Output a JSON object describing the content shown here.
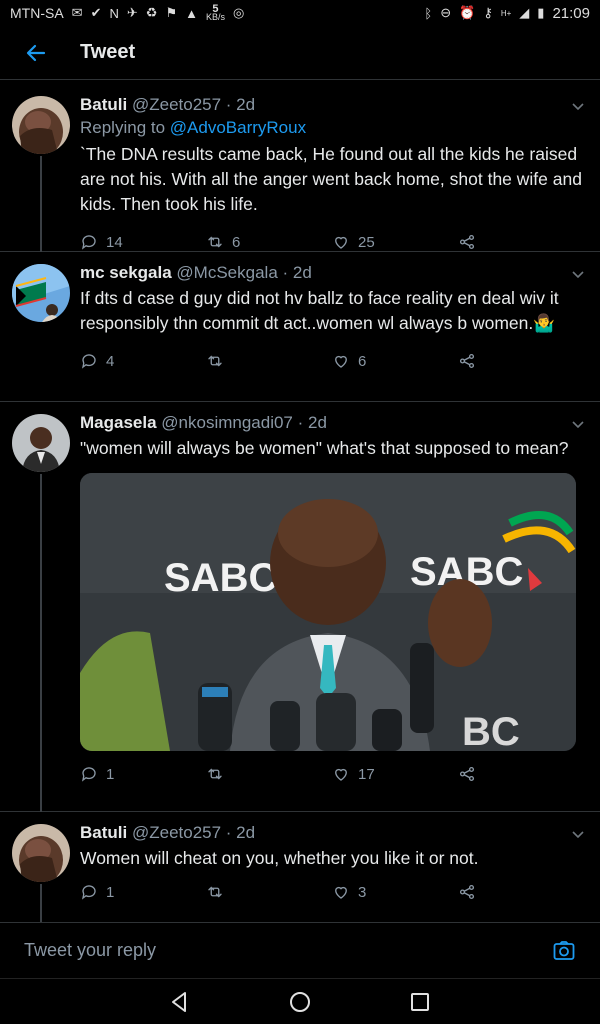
{
  "status_bar": {
    "carrier": "MTN-SA",
    "kb_value": "5",
    "kb_unit": "KB/s",
    "time": "21:09",
    "network": "H+"
  },
  "header": {
    "title": "Tweet",
    "back_icon": "arrow-left-icon"
  },
  "colors": {
    "accent": "#1d9bf0",
    "background": "#000000",
    "text": "#e7e9ea",
    "muted": "#8b98a5",
    "divider": "#2f3336"
  },
  "tweets": [
    {
      "name": "Batuli",
      "handle": "@Zeeto257",
      "age": "· 2d",
      "replying_prefix": "Replying to ",
      "replying_to": "@AdvoBarryRoux",
      "text": "`The DNA results came back, He found out all the kids he raised are not his. With all the anger went back home, shot the wife and kids. Then took his life.",
      "replies": "14",
      "retweets": "6",
      "likes": "25"
    },
    {
      "name": "mc sekgala",
      "handle": "@McSekgala",
      "age": "· 2d",
      "text": "If dts d case d guy did not hv ballz to face reality en deal wiv it responsibly thn commit dt act..women wl always b women.🤷‍♂",
      "replies": "4",
      "retweets": "",
      "likes": "6"
    },
    {
      "name": "Magasela",
      "handle": "@nkosimngadi07",
      "age": "· 2d",
      "text": "\"women will always be women\" what's that supposed to mean?",
      "media_logo_1": "SABC",
      "media_logo_2": "SABC",
      "media_logo_3": "BC",
      "replies": "1",
      "retweets": "",
      "likes": "17"
    },
    {
      "name": "Batuli",
      "handle": "@Zeeto257",
      "age": "· 2d",
      "text": "Women will cheat on you, whether you like it or not.",
      "replies": "1",
      "retweets": "",
      "likes": "3"
    }
  ],
  "reply_bar": {
    "placeholder": "Tweet your reply",
    "camera_icon": "camera-icon"
  },
  "nav_bar": {
    "back": "back-triangle-icon",
    "home": "home-circle-icon",
    "recents": "recents-square-icon"
  }
}
